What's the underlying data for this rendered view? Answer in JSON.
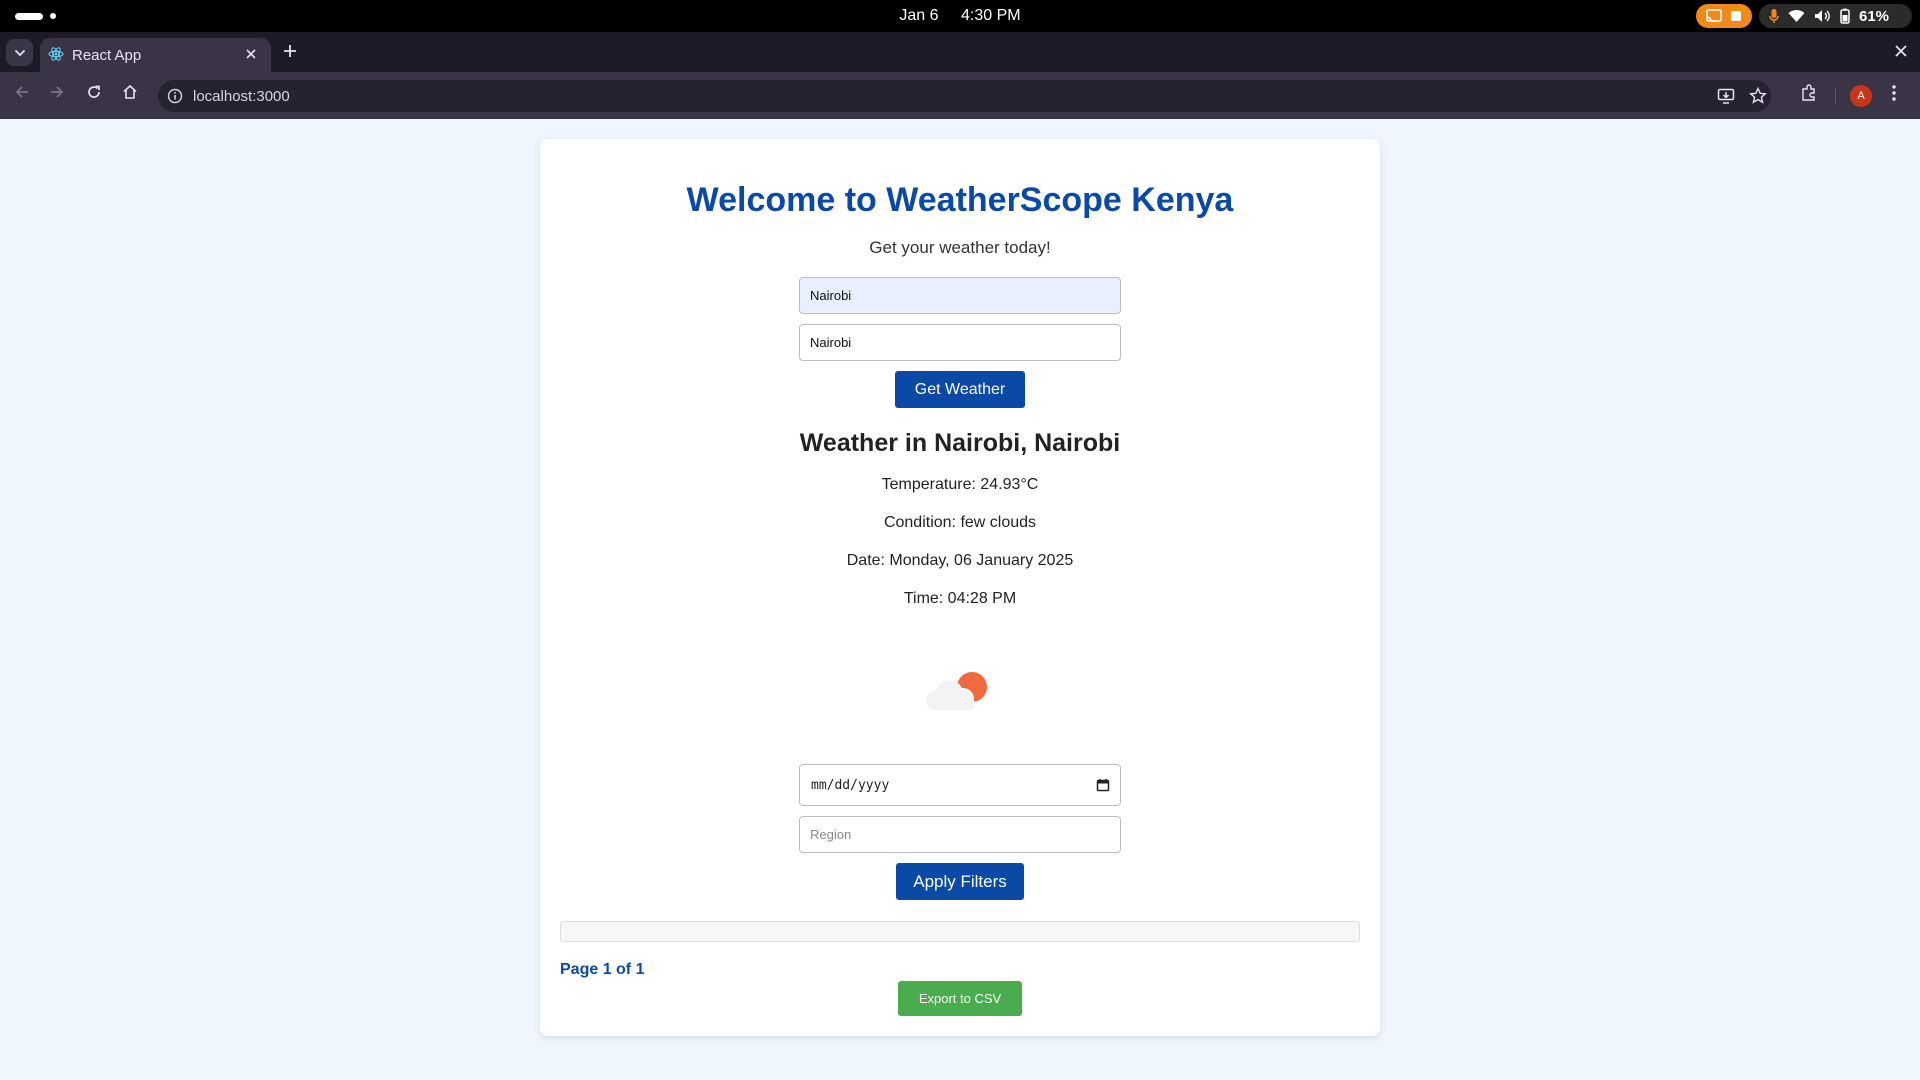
{
  "os": {
    "date": "Jan 6",
    "time": "4:30 PM",
    "battery": "61%"
  },
  "browser": {
    "tab_title": "React App",
    "url": "localhost:3000",
    "profile_initial": "A"
  },
  "app": {
    "title": "Welcome to WeatherScope Kenya",
    "subtitle": "Get your weather today!",
    "city_value": "Nairobi",
    "region_value": "Nairobi",
    "get_weather_label": "Get Weather",
    "weather_heading": "Weather in Nairobi, Nairobi",
    "temperature": "Temperature: 24.93°C",
    "condition": "Condition: few clouds",
    "date": "Date: Monday, 06 January 2025",
    "time": "Time: 04:28 PM",
    "weather_icon": "few-clouds-icon",
    "filters": {
      "date_placeholder": "mm/dd/yyyy",
      "region_placeholder": "Region",
      "apply_label": "Apply Filters"
    },
    "pagination": "Page 1 of 1",
    "export_label": "Export to CSV"
  },
  "colors": {
    "primary": "#0a4aa6",
    "export_green": "#4aab4f",
    "page_bg": "#f0f6fd",
    "sun": "#ef6a3f"
  }
}
